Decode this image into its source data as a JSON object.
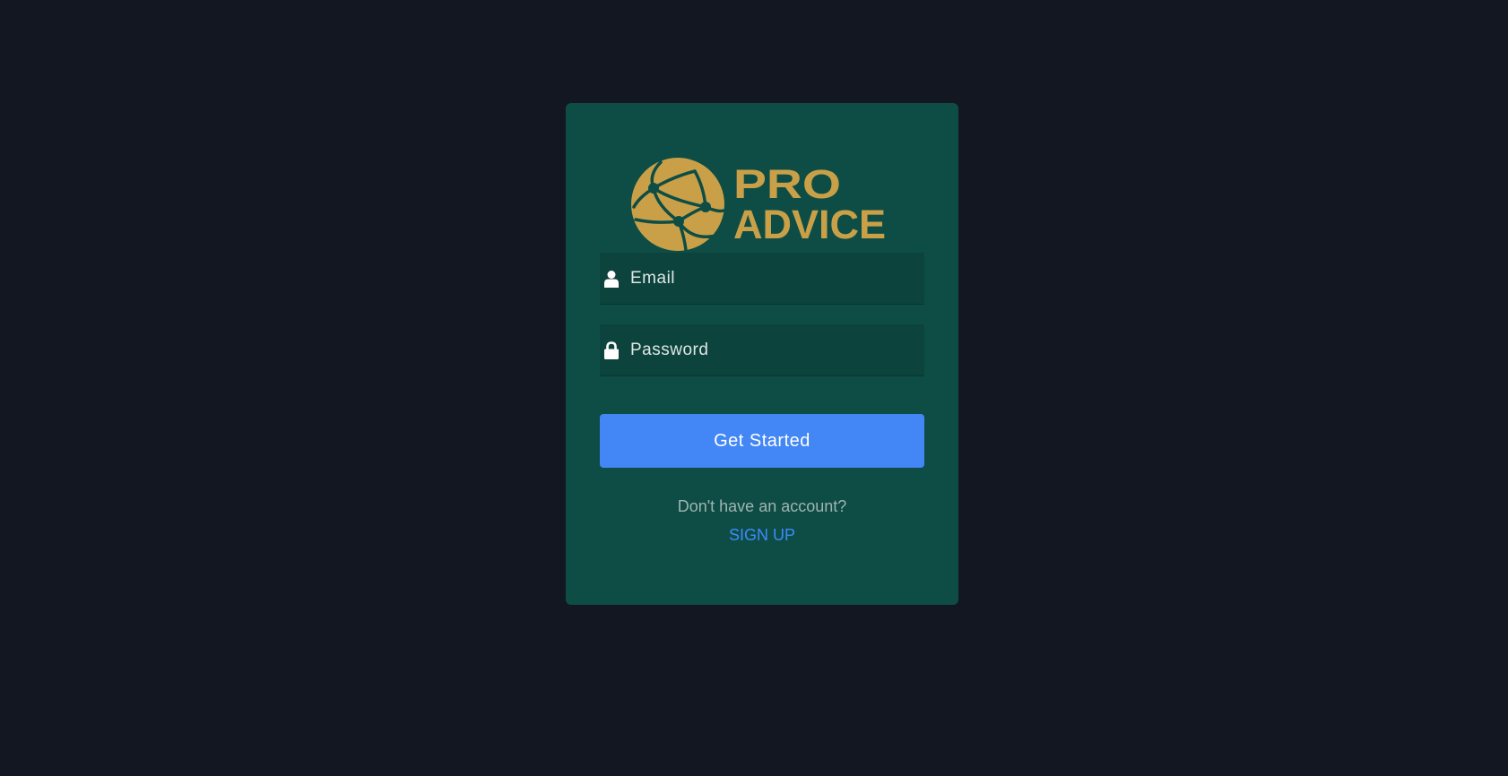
{
  "brand": {
    "line1": "PRO",
    "line2": "ADVICE",
    "color": "#c9a048"
  },
  "form": {
    "email_placeholder": "Email",
    "email_value": "",
    "password_placeholder": "Password",
    "password_value": "",
    "email_icon": "user-icon",
    "password_icon": "lock-icon"
  },
  "actions": {
    "submit_label": "Get Started",
    "no_account_text": "Don't have an account?",
    "signup_label": "SIGN UP"
  },
  "colors": {
    "page_background": "#121722",
    "card_background": "#0e4d45",
    "field_background": "#0c443d",
    "button": "#4287f5",
    "link": "#3d8bfd"
  }
}
